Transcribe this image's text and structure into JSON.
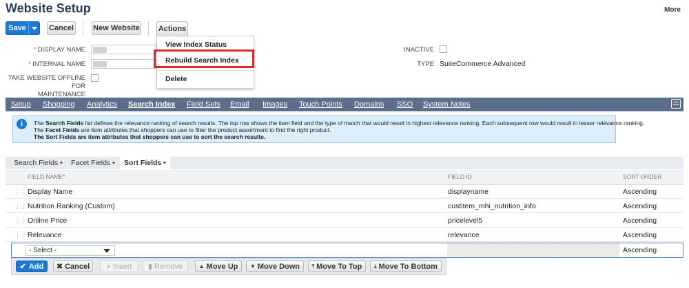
{
  "page": {
    "title": "Website Setup",
    "more_label": "More"
  },
  "toolbar": {
    "save_label": "Save",
    "cancel_label": "Cancel",
    "new_website_label": "New Website",
    "actions_label": "Actions"
  },
  "actions_menu": {
    "items": [
      "View Index Status",
      "Rebuild Search Index",
      "Delete"
    ],
    "highlighted": "Rebuild Search Index"
  },
  "form": {
    "display_name_label": "DISPLAY NAME",
    "internal_name_label": "INTERNAL NAME",
    "take_offline_label_1": "TAKE WEBSITE OFFLINE FOR",
    "take_offline_label_2": "MAINTENANCE",
    "inactive_label": "INACTIVE",
    "type_label": "TYPE",
    "type_value": "SuiteCommerce Advanced",
    "required_marker": "*"
  },
  "tabs": [
    "Setup",
    "Shopping",
    "Analytics",
    "Search Index",
    "Field Sets",
    "Email",
    "Images",
    "Touch Points",
    "Domains",
    "SSO",
    "System Notes"
  ],
  "active_tab": "Search Index",
  "info": {
    "line1_bold": "Search Fields",
    "line1_pre": "The ",
    "line1_rest": " list defines the relevance ranking of search results. The top row shows the item field and the type of match that would result in highest relevance ranking. Each subsequent row would result in lesser relevance ranking.",
    "line2_pre": "The ",
    "line2_bold": "Facet Fields",
    "line2_rest": " are item attributes that shoppers can use to filter the product assortment to find the right product.",
    "line3": "The Sort Fields are item attributes that shoppers can use to sort the search results."
  },
  "subtabs": [
    "Search Fields •",
    "Facet Fields •",
    "Sort Fields •"
  ],
  "active_subtab": "Sort Fields •",
  "table": {
    "headers": {
      "field_name": "FIELD NAME",
      "required": "*",
      "field_id": "FIELD ID",
      "sort_order": "SORT ORDER"
    },
    "rows": [
      {
        "name": "Display Name",
        "id": "displayname",
        "order": "Ascending"
      },
      {
        "name": "Nutrition Ranking (Custom)",
        "id": "custitem_mhi_nutrition_info",
        "order": "Ascending"
      },
      {
        "name": "Online Price",
        "id": "pricelevel5",
        "order": "Ascending"
      },
      {
        "name": "Relevance",
        "id": "relevance",
        "order": "Ascending"
      }
    ],
    "edit_row": {
      "select_value": "- Select -",
      "order": "Ascending"
    }
  },
  "row_actions": {
    "add": "Add",
    "cancel": "Cancel",
    "insert": "Insert",
    "remove": "Remove",
    "move_up": "Move Up",
    "move_down": "Move Down",
    "move_top": "Move To Top",
    "move_bottom": "Move To Bottom"
  },
  "colors": {
    "accent": "#1a78d6",
    "tabbar": "#5b6e8c",
    "highlight": "#e02828",
    "title": "#2b3e5b"
  }
}
